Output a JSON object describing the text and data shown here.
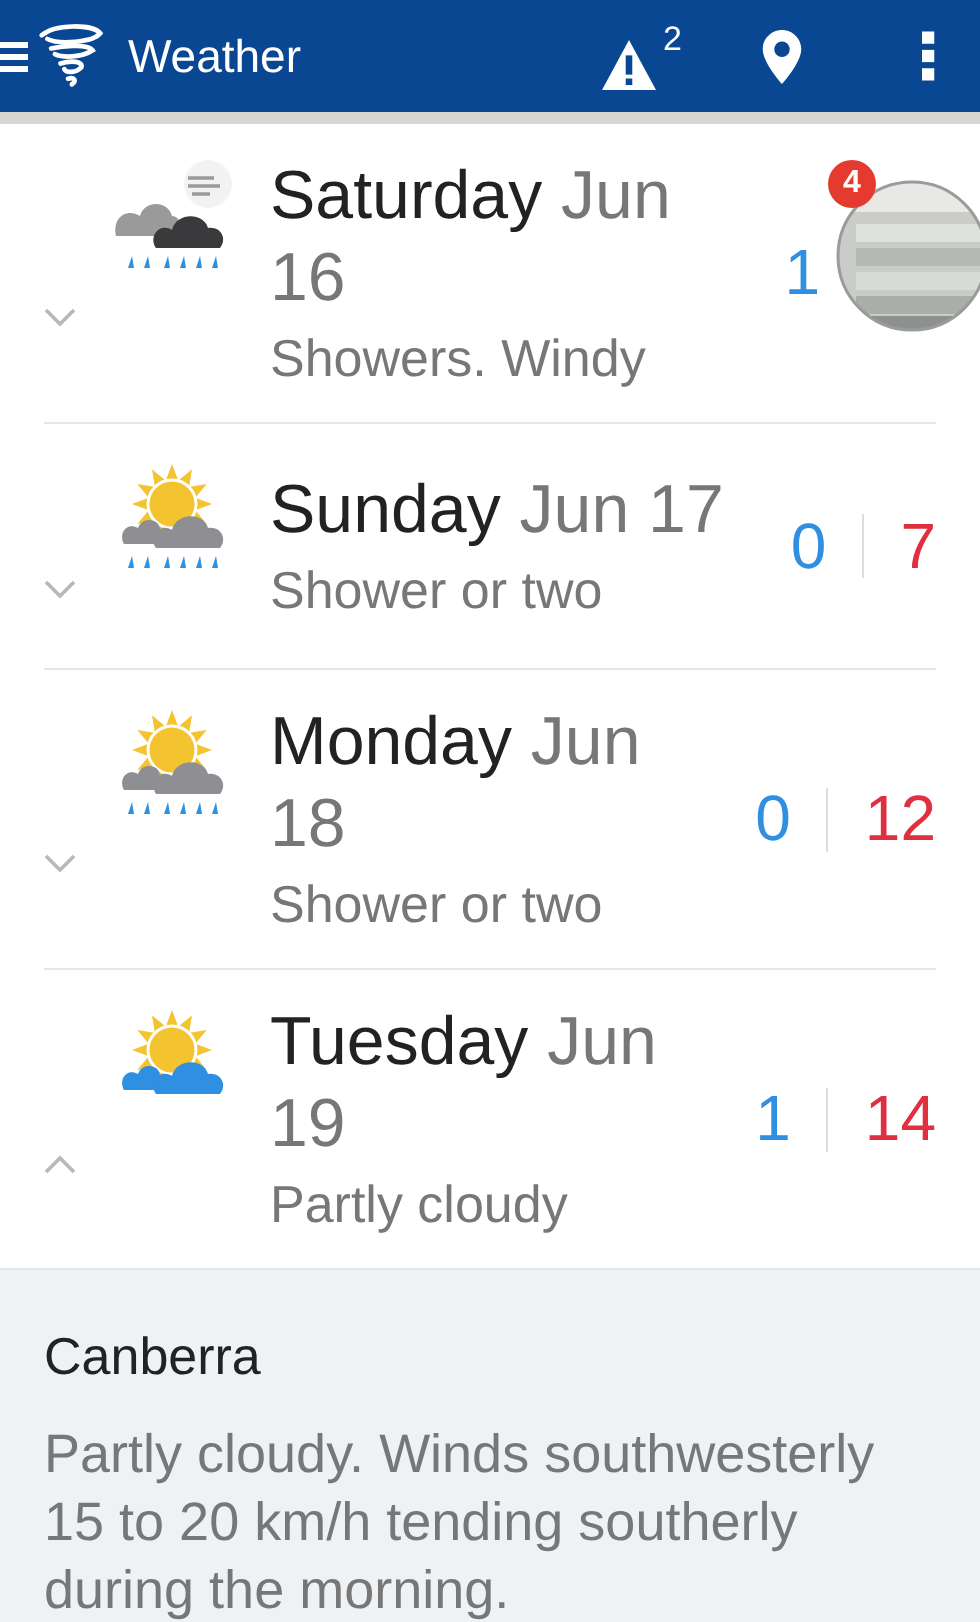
{
  "app_bar": {
    "title": "Weather",
    "warnings_count": "2"
  },
  "days": [
    {
      "day": "Saturday",
      "date": "Jun 16",
      "summary": "Showers. Windy",
      "kind": "showers-windy",
      "min": "1",
      "expanded": false
    },
    {
      "day": "Sunday",
      "date": "Jun 17",
      "summary": "Shower or two",
      "kind": "sun-showers",
      "min": "0",
      "max": "7",
      "expanded": false
    },
    {
      "day": "Monday",
      "date": "Jun 18",
      "summary": "Shower or two",
      "kind": "sun-showers",
      "min": "0",
      "max": "12",
      "expanded": false
    },
    {
      "day": "Tuesday",
      "date": "Jun 19",
      "summary": "Partly cloudy",
      "kind": "partly-cloudy",
      "min": "1",
      "max": "14",
      "expanded": true
    }
  ],
  "chat_head": {
    "kind": "picture",
    "badge": "4"
  },
  "detail": {
    "location": "Canberra",
    "forecast": "Partly cloudy. Winds southwesterly 15 to 20 km/h tending southerly during the morning."
  }
}
